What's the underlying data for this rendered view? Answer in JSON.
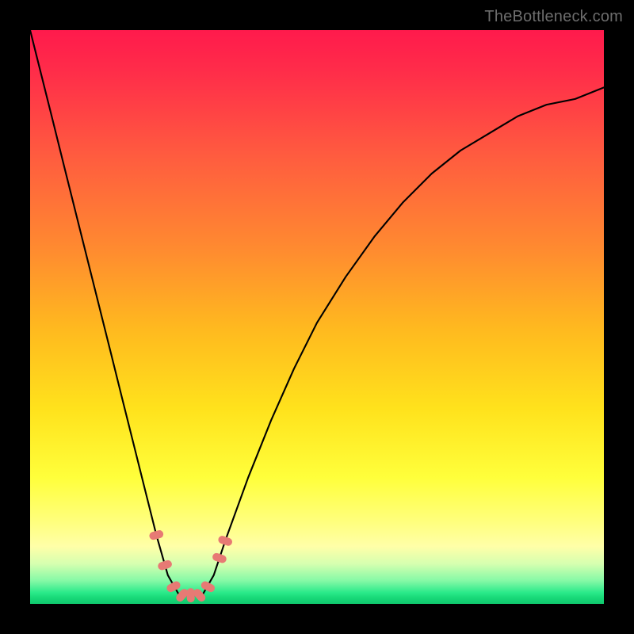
{
  "watermark": "TheBottleneck.com",
  "colors": {
    "curve_stroke": "#000000",
    "marker_fill": "#e77a74",
    "gradient_stops": [
      "#ff1a4c",
      "#ff2f49",
      "#ff5c3f",
      "#ff8a30",
      "#ffb91f",
      "#ffe21c",
      "#ffff3b",
      "#ffff80",
      "#ffffa8",
      "#d6ffb0",
      "#84f9a6",
      "#2bea8a",
      "#17d877",
      "#10c96e"
    ]
  },
  "chart_data": {
    "type": "line",
    "title": "",
    "xlabel": "",
    "ylabel": "",
    "x": [
      0.0,
      0.02,
      0.04,
      0.06,
      0.08,
      0.1,
      0.12,
      0.14,
      0.16,
      0.18,
      0.2,
      0.22,
      0.24,
      0.26,
      0.28,
      0.3,
      0.32,
      0.34,
      0.38,
      0.42,
      0.46,
      0.5,
      0.55,
      0.6,
      0.65,
      0.7,
      0.75,
      0.8,
      0.85,
      0.9,
      0.95,
      1.0
    ],
    "series": [
      {
        "name": "curve",
        "values": [
          1.0,
          0.92,
          0.84,
          0.76,
          0.68,
          0.6,
          0.52,
          0.44,
          0.36,
          0.28,
          0.2,
          0.12,
          0.05,
          0.01,
          0.0,
          0.01,
          0.05,
          0.11,
          0.22,
          0.32,
          0.41,
          0.49,
          0.57,
          0.64,
          0.7,
          0.75,
          0.79,
          0.82,
          0.85,
          0.87,
          0.88,
          0.9
        ]
      }
    ],
    "xlim": [
      0,
      1
    ],
    "ylim": [
      0,
      1
    ],
    "markers_x": [
      0.22,
      0.235,
      0.25,
      0.265,
      0.28,
      0.295,
      0.31,
      0.33,
      0.34
    ],
    "note": "V-shaped bottleneck curve over rainbow heatmap; minimum ~x=0.28; salmon markers cluster near the notch."
  }
}
